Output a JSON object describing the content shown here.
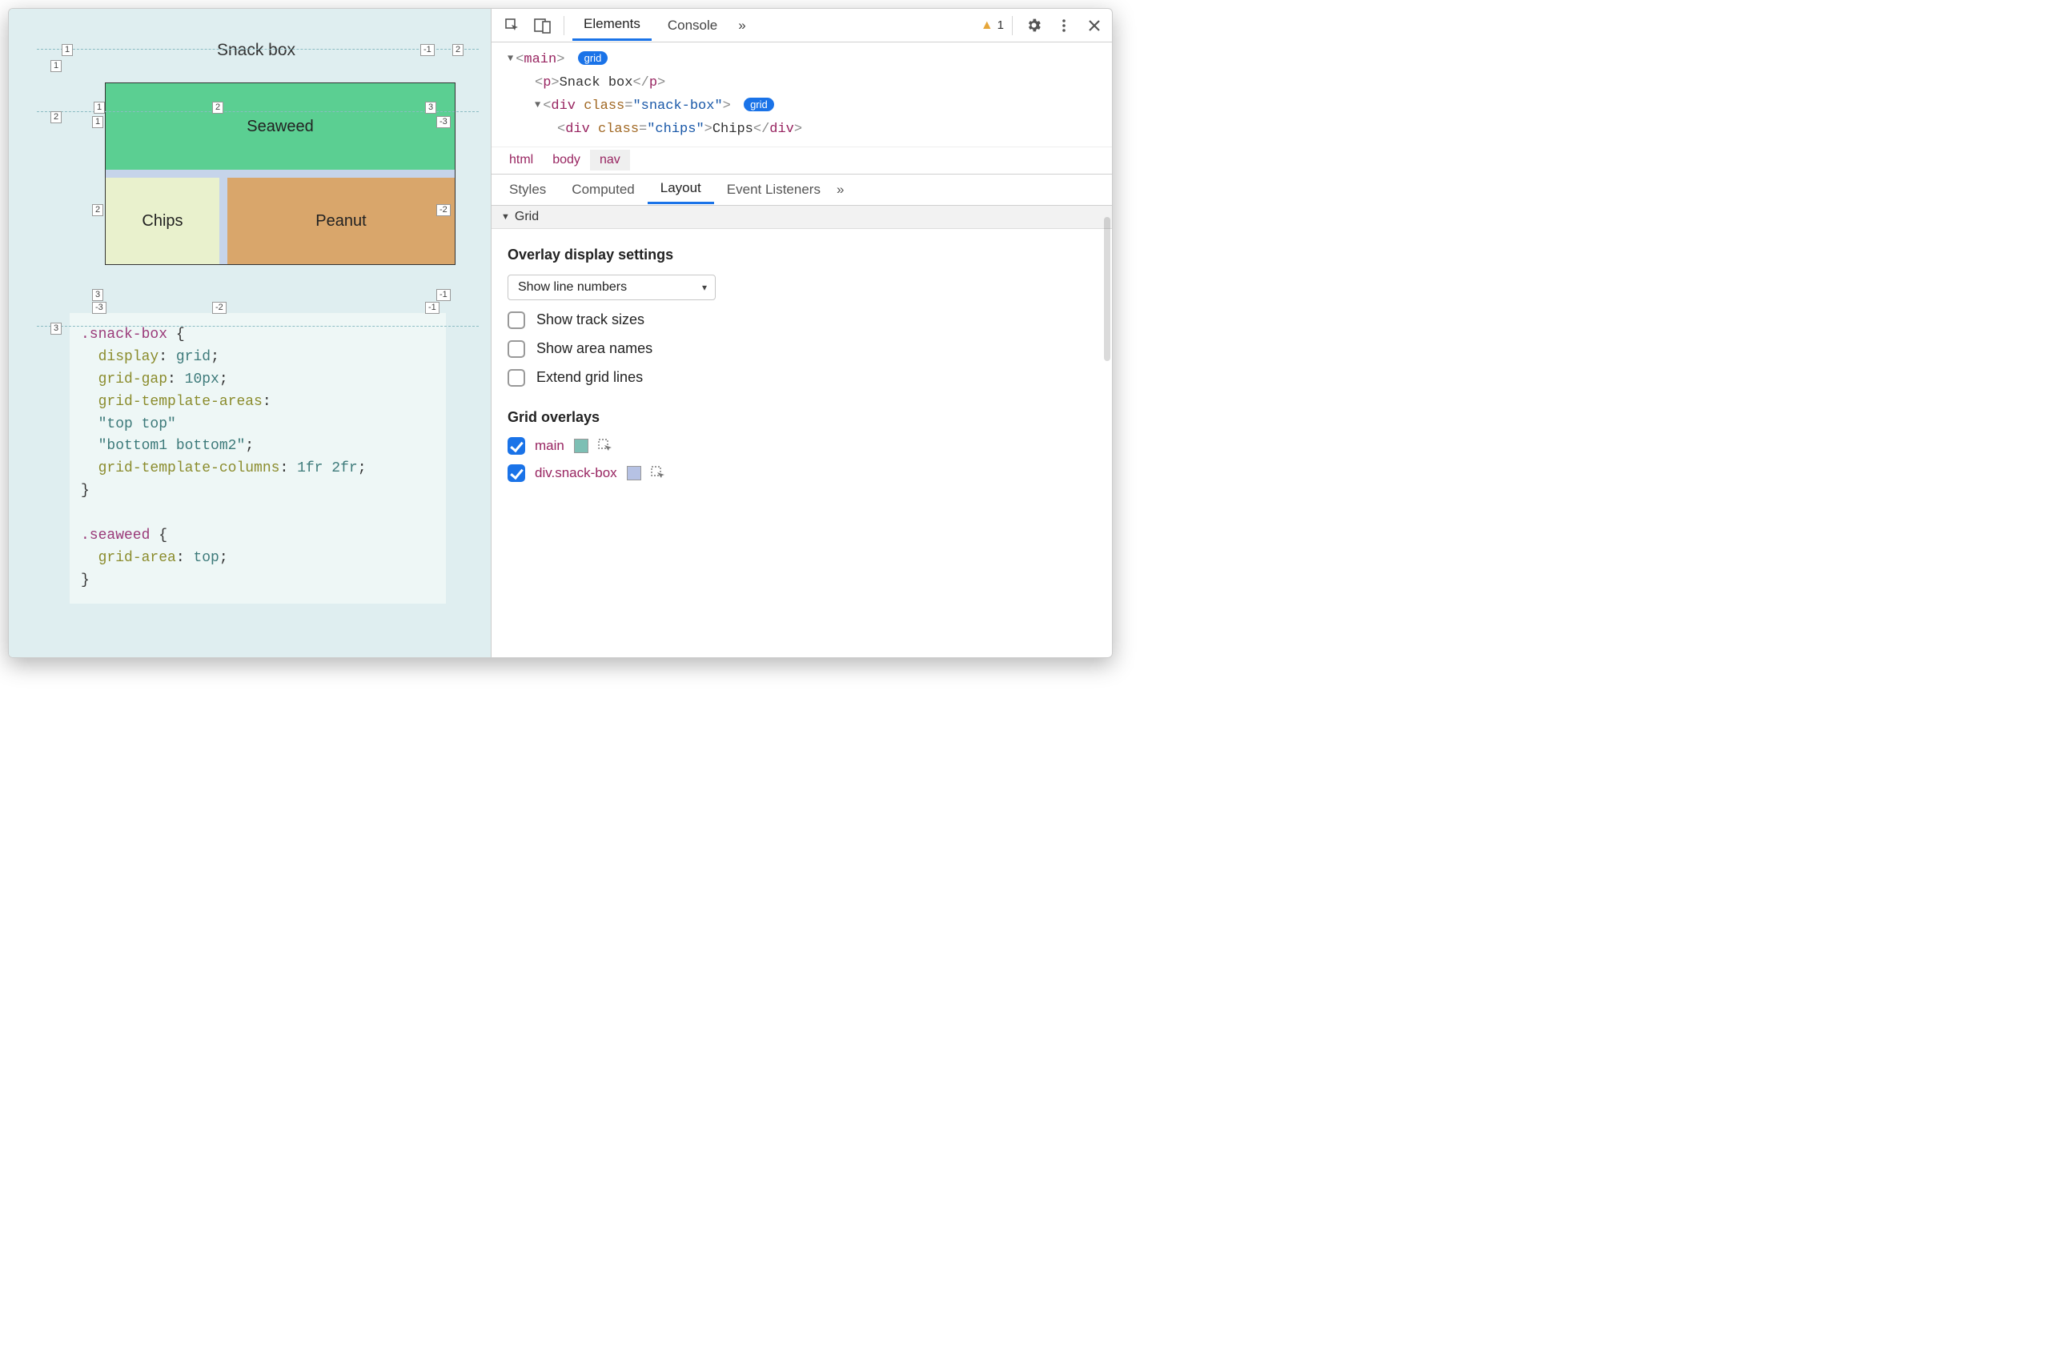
{
  "page": {
    "title": "Snack box",
    "grid_cells": {
      "seaweed": "Seaweed",
      "chips": "Chips",
      "peanut": "Peanut"
    },
    "line_numbers": {
      "outer_cols_top": [
        "1",
        "-1",
        "2"
      ],
      "outer_rows_left": [
        "1",
        "2",
        "3"
      ],
      "box_cols_top": [
        "1",
        "2",
        "3"
      ],
      "box_cols_top_neg": [
        "-3"
      ],
      "box_rows_left": [
        "1",
        "2",
        "3"
      ],
      "box_rows_right": [
        "-2",
        "-1"
      ],
      "box_cols_bottom": [
        "-3",
        "-2",
        "-1"
      ]
    },
    "code_lines": [
      {
        "t": "sel",
        "v": ".snack-box"
      },
      {
        "t": "plain",
        "v": " {"
      },
      {
        "t": "br"
      },
      {
        "t": "indent"
      },
      {
        "t": "prop",
        "v": "display"
      },
      {
        "t": "plain",
        "v": ": "
      },
      {
        "t": "val",
        "v": "grid"
      },
      {
        "t": "plain",
        "v": ";"
      },
      {
        "t": "br"
      },
      {
        "t": "indent"
      },
      {
        "t": "prop",
        "v": "grid-gap"
      },
      {
        "t": "plain",
        "v": ": "
      },
      {
        "t": "val",
        "v": "10px"
      },
      {
        "t": "plain",
        "v": ";"
      },
      {
        "t": "br"
      },
      {
        "t": "indent"
      },
      {
        "t": "prop",
        "v": "grid-template-areas"
      },
      {
        "t": "plain",
        "v": ":"
      },
      {
        "t": "br"
      },
      {
        "t": "indent"
      },
      {
        "t": "str",
        "v": "\"top top\""
      },
      {
        "t": "br"
      },
      {
        "t": "indent"
      },
      {
        "t": "str",
        "v": "\"bottom1 bottom2\""
      },
      {
        "t": "plain",
        "v": ";"
      },
      {
        "t": "br"
      },
      {
        "t": "indent"
      },
      {
        "t": "prop",
        "v": "grid-template-columns"
      },
      {
        "t": "plain",
        "v": ": "
      },
      {
        "t": "val",
        "v": "1fr 2fr"
      },
      {
        "t": "plain",
        "v": ";"
      },
      {
        "t": "br"
      },
      {
        "t": "plain",
        "v": "}"
      },
      {
        "t": "br"
      },
      {
        "t": "br"
      },
      {
        "t": "sel",
        "v": ".seaweed"
      },
      {
        "t": "plain",
        "v": " {"
      },
      {
        "t": "br"
      },
      {
        "t": "indent"
      },
      {
        "t": "prop",
        "v": "grid-area"
      },
      {
        "t": "plain",
        "v": ": "
      },
      {
        "t": "val",
        "v": "top"
      },
      {
        "t": "plain",
        "v": ";"
      },
      {
        "t": "br"
      },
      {
        "t": "plain",
        "v": "}"
      }
    ]
  },
  "devtools": {
    "tabs": {
      "elements": "Elements",
      "console": "Console",
      "more": "»"
    },
    "warning_count": "1",
    "dom": {
      "main_tag": "main",
      "grid_badge": "grid",
      "p_tag": "p",
      "p_text": "Snack box",
      "div_tag": "div",
      "class_attr": "class",
      "snackbox_class": "\"snack-box\"",
      "chips_class": "\"chips\"",
      "chips_text": "Chips"
    },
    "breadcrumb": [
      "html",
      "body",
      "nav"
    ],
    "side_tabs": {
      "styles": "Styles",
      "computed": "Computed",
      "layout": "Layout",
      "event": "Event Listeners",
      "more": "»"
    },
    "grid_section": {
      "title": "Grid",
      "overlay_heading": "Overlay display settings",
      "dropdown_value": "Show line numbers",
      "checkboxes": [
        {
          "label": "Show track sizes",
          "checked": false
        },
        {
          "label": "Show area names",
          "checked": false
        },
        {
          "label": "Extend grid lines",
          "checked": false
        }
      ],
      "overlays_heading": "Grid overlays",
      "overlays": [
        {
          "name": "main",
          "checked": true,
          "swatch": "#7dbfb4"
        },
        {
          "name": "div.snack-box",
          "checked": true,
          "swatch": "#b6c2e4"
        }
      ]
    }
  }
}
